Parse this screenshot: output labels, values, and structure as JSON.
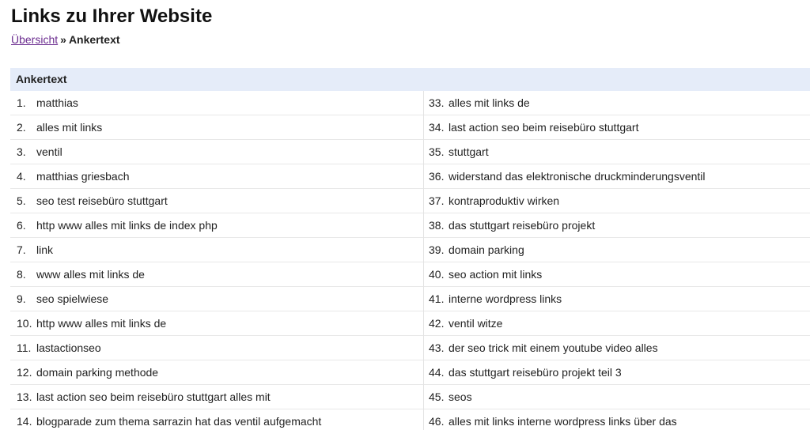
{
  "page": {
    "title": "Links zu Ihrer Website"
  },
  "breadcrumb": {
    "parent_label": "Übersicht",
    "separator": "»",
    "current_label": "Ankertext"
  },
  "table": {
    "header": "Ankertext",
    "left_rows": [
      {
        "num": "1.",
        "text": "matthias"
      },
      {
        "num": "2.",
        "text": "alles mit links"
      },
      {
        "num": "3.",
        "text": "ventil"
      },
      {
        "num": "4.",
        "text": "matthias griesbach"
      },
      {
        "num": "5.",
        "text": "seo test reisebüro stuttgart"
      },
      {
        "num": "6.",
        "text": "http www alles mit links de index php"
      },
      {
        "num": "7.",
        "text": "link"
      },
      {
        "num": "8.",
        "text": "www alles mit links de"
      },
      {
        "num": "9.",
        "text": "seo spielwiese"
      },
      {
        "num": "10.",
        "text": "http www alles mit links de"
      },
      {
        "num": "11.",
        "text": "lastactionseo"
      },
      {
        "num": "12.",
        "text": "domain parking methode"
      },
      {
        "num": "13.",
        "text": "last action seo beim reisebüro stuttgart alles mit"
      },
      {
        "num": "14.",
        "text": "blogparade zum thema sarrazin hat das ventil aufgemacht"
      }
    ],
    "right_rows": [
      {
        "num": "33.",
        "text": "alles mit links de"
      },
      {
        "num": "34.",
        "text": "last action seo beim reisebüro stuttgart"
      },
      {
        "num": "35.",
        "text": "stuttgart"
      },
      {
        "num": "36.",
        "text": "widerstand das elektronische druckminderungsventil"
      },
      {
        "num": "37.",
        "text": "kontraproduktiv wirken"
      },
      {
        "num": "38.",
        "text": "das stuttgart reisebüro projekt"
      },
      {
        "num": "39.",
        "text": "domain parking"
      },
      {
        "num": "40.",
        "text": "seo action mit links"
      },
      {
        "num": "41.",
        "text": "interne wordpress links"
      },
      {
        "num": "42.",
        "text": "ventil witze"
      },
      {
        "num": "43.",
        "text": "der seo trick mit einem youtube video alles"
      },
      {
        "num": "44.",
        "text": "das stuttgart reisebüro projekt teil 3"
      },
      {
        "num": "45.",
        "text": "seos"
      },
      {
        "num": "46.",
        "text": "alles mit links interne wordpress links über das"
      }
    ]
  }
}
